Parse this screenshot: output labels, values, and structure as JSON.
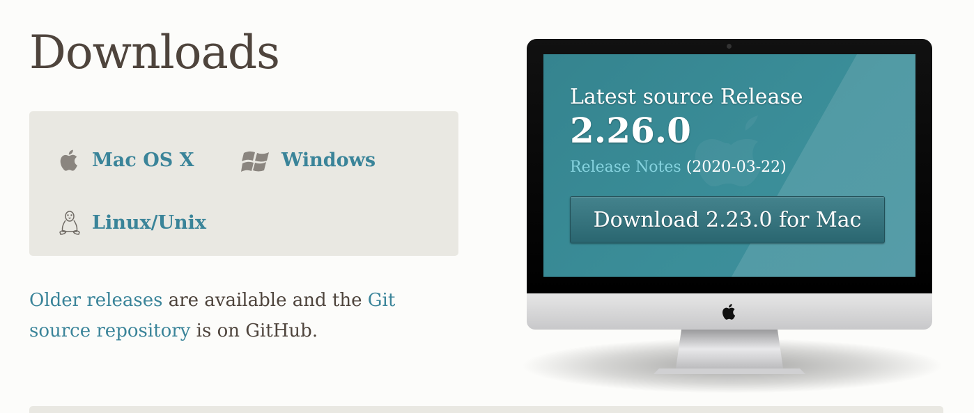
{
  "page": {
    "title": "Downloads"
  },
  "os_links": {
    "mac": "Mac OS X",
    "windows": "Windows",
    "linux": "Linux/Unix"
  },
  "older": {
    "link1": "Older releases",
    "text1": " are available and the ",
    "link2": "Git source repository",
    "text2": " is on GitHub."
  },
  "release": {
    "heading": "Latest source Release",
    "version": "2.26.0",
    "notes_link": "Release Notes",
    "date": "(2020-03-22)",
    "download_button": "Download 2.23.0 for Mac"
  },
  "colors": {
    "link": "#3a8499",
    "screen": "#3b8e99",
    "panel": "#e9e8e2"
  },
  "icons": {
    "mac": "apple-icon",
    "windows": "windows-icon",
    "linux": "tux-icon"
  }
}
